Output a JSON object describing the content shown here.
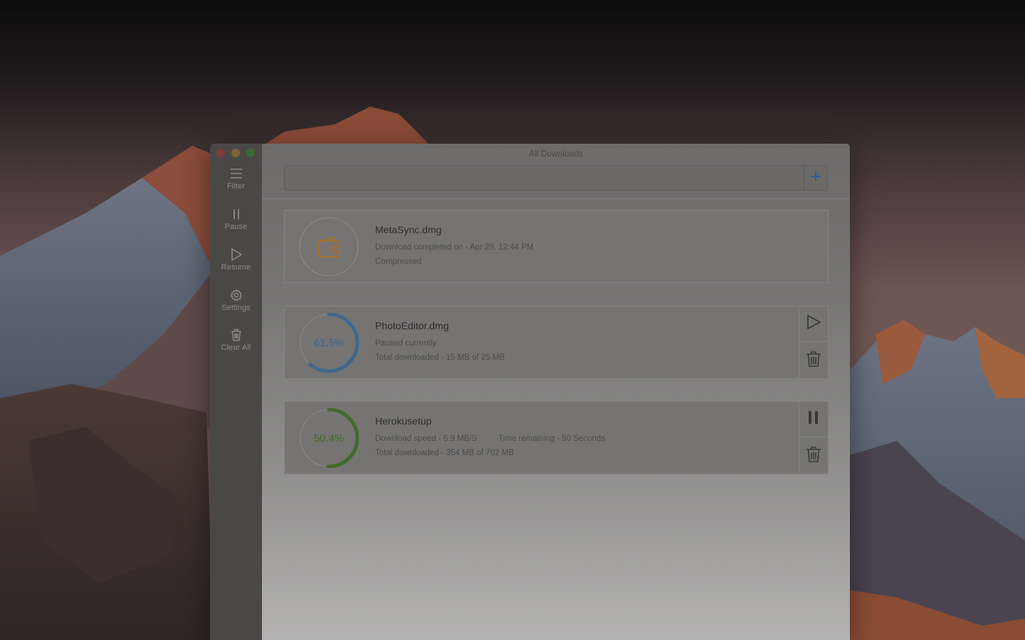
{
  "window": {
    "title": "All Downloads"
  },
  "sidebar": {
    "items": [
      {
        "label": "Filter",
        "icon": "filter-icon"
      },
      {
        "label": "Pause",
        "icon": "pause-icon"
      },
      {
        "label": "Resume",
        "icon": "resume-icon"
      },
      {
        "label": "Settings",
        "icon": "gear-icon"
      },
      {
        "label": "Clear All",
        "icon": "trash-icon"
      }
    ]
  },
  "toolbar": {
    "url_value": "",
    "url_placeholder": "",
    "add_icon": "plus-icon"
  },
  "downloads": [
    {
      "name": "MetaSync.dmg",
      "status": "Download completed on - Apr 29, 12:44 PM",
      "detail": "Compressed",
      "state": "completed",
      "icon": "wallet-icon"
    },
    {
      "name": "PhotoEditor.dmg",
      "percent_label": "61.5%",
      "progress": 0.615,
      "status": "Paused currently",
      "detail": "Total downloaded - 15 MB of 25 MB",
      "state": "paused",
      "action_icon": "play-icon"
    },
    {
      "name": "Herokusetup",
      "percent_label": "50.4%",
      "progress": 0.504,
      "speed": "Download speed - 6.9 MB/S",
      "remaining": "Time remaining - 50 Seconds",
      "detail": "Total downloaded - 354 MB of 702 MB",
      "state": "downloading",
      "action_icon": "pause-icon"
    }
  ],
  "colors": {
    "completed_accent": "#a56f2a",
    "paused_accent": "#3d6890",
    "downloading_accent": "#3f6a2a",
    "plus_accent": "#2c5f95"
  }
}
